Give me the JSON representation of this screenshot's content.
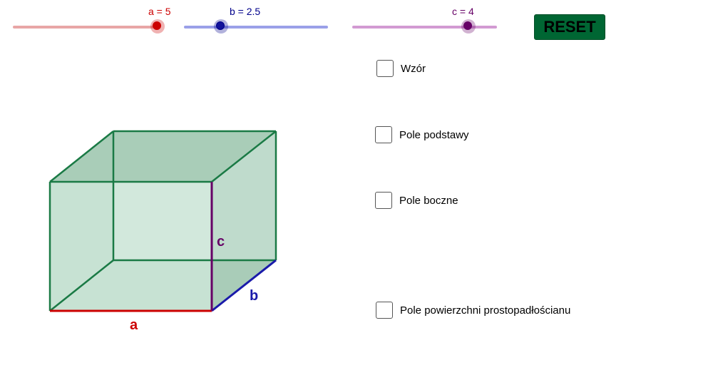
{
  "sliders": {
    "a": {
      "label": "a = 5",
      "value": 5,
      "min": 0,
      "max": 5,
      "color": "#cc0000",
      "track": "#e8a6a6",
      "knob": "#cc0000"
    },
    "b": {
      "label": "b = 2.5",
      "value": 2.5,
      "min": 0,
      "max": 10,
      "color": "#00008b",
      "track": "#9aa0e8",
      "knob": "#1a1aa0"
    },
    "c": {
      "label": "c = 4",
      "value": 4,
      "min": 0,
      "max": 5,
      "color": "#660066",
      "track": "#d29ad2",
      "knob": "#660066"
    }
  },
  "reset_label": "RESET",
  "checkboxes": [
    {
      "label": "Wzór",
      "checked": false
    },
    {
      "label": "Pole podstawy",
      "checked": false
    },
    {
      "label": "Pole boczne",
      "checked": false
    },
    {
      "label": "Pole powierzchni prostopadłościanu",
      "checked": false
    }
  ],
  "cuboid": {
    "edge_labels": {
      "a": "a",
      "b": "b",
      "c": "c"
    },
    "colors": {
      "edge": "#1a7a45",
      "fill_light": "#d2e8dc",
      "fill_dark": "#a9cdb8",
      "edge_a": "#cc0000",
      "edge_b": "#1a1aaa",
      "edge_c": "#660066"
    }
  }
}
